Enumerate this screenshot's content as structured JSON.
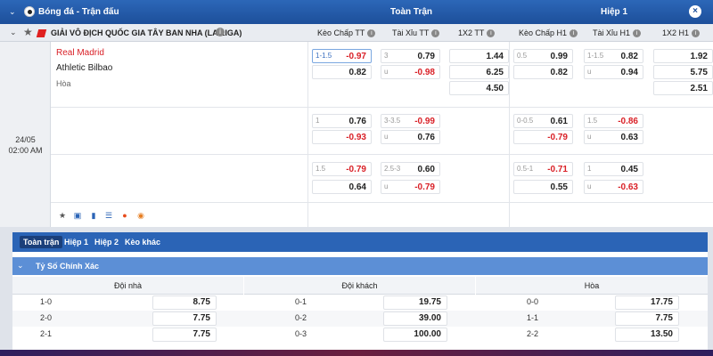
{
  "header": {
    "title": "Bóng đá - Trận đấu",
    "full_match": "Toàn Trận",
    "first_half": "Hiệp 1"
  },
  "league": {
    "name": "GIẢI VÔ ĐỊCH QUỐC GIA TÂY BAN NHA (LA LIGA)",
    "columns": [
      "Kèo Chấp TT",
      "Tài Xỉu TT",
      "1X2 TT",
      "Kèo Chấp H1",
      "Tài Xỉu H1",
      "1X2 H1"
    ]
  },
  "match": {
    "home": "Real Madrid",
    "away": "Athletic Bilbao",
    "draw": "Hòa",
    "date": "24/05",
    "time": "02:00 AM"
  },
  "odds_rows": [
    {
      "hdp_tt": {
        "line": "1-1.5",
        "home": "-0.97",
        "away": "0.82"
      },
      "ou_tt": {
        "line": "3",
        "over": "0.79",
        "u": "u",
        "under": "-0.98"
      },
      "x12_tt": [
        "1.44",
        "6.25",
        "4.50"
      ],
      "hdp_h1": {
        "line": "0.5",
        "home": "0.99",
        "away": "0.82"
      },
      "ou_h1": {
        "line": "1-1.5",
        "over": "0.82",
        "u": "u",
        "under": "0.94"
      },
      "x12_h1": [
        "1.92",
        "5.75",
        "2.51"
      ]
    },
    {
      "hdp_tt": {
        "line": "1",
        "home": "0.76",
        "away": "-0.93"
      },
      "ou_tt": {
        "line": "3-3.5",
        "over": "-0.99",
        "u": "u",
        "under": "0.76"
      },
      "hdp_h1": {
        "line": "0-0.5",
        "home": "0.61",
        "away": "-0.79"
      },
      "ou_h1": {
        "line": "1.5",
        "over": "-0.86",
        "u": "u",
        "under": "0.63"
      }
    },
    {
      "hdp_tt": {
        "line": "1.5",
        "home": "-0.79",
        "away": "0.64"
      },
      "ou_tt": {
        "line": "2.5-3",
        "over": "0.60",
        "u": "u",
        "under": "-0.79"
      },
      "hdp_h1": {
        "line": "0.5-1",
        "home": "-0.71",
        "away": "0.55"
      },
      "ou_h1": {
        "line": "1",
        "over": "0.45",
        "u": "u",
        "under": "-0.63"
      }
    }
  ],
  "tabs": [
    "Toàn trận",
    "Hiệp 1",
    "Hiệp 2",
    "Kèo khác"
  ],
  "correct_score": {
    "title": "Tỷ Số Chính Xác",
    "headers": [
      "Đội nhà",
      "Đội khách",
      "Hòa"
    ],
    "home": [
      [
        "1-0",
        "8.75"
      ],
      [
        "2-0",
        "7.75"
      ],
      [
        "2-1",
        "7.75"
      ]
    ],
    "away": [
      [
        "0-1",
        "19.75"
      ],
      [
        "0-2",
        "39.00"
      ],
      [
        "0-3",
        "100.00"
      ]
    ],
    "draw": [
      [
        "0-0",
        "17.75"
      ],
      [
        "1-1",
        "7.75"
      ],
      [
        "2-2",
        "13.50"
      ]
    ]
  },
  "colors": {
    "header": "#1d4f9a",
    "negative": "#d92027",
    "tab": "#2b64b6"
  }
}
